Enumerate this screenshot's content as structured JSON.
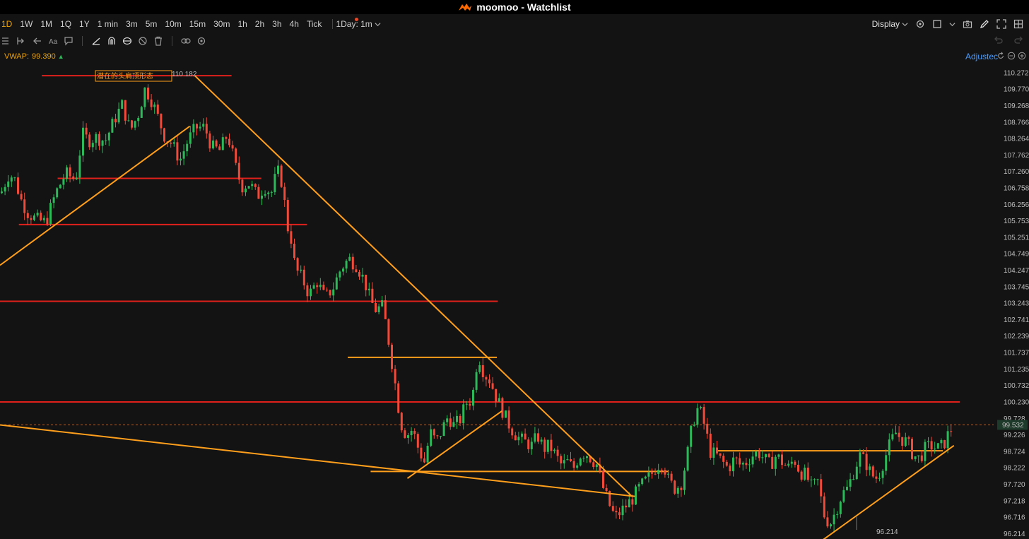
{
  "app": {
    "title": "moomoo - Watchlist"
  },
  "periods": [
    "1D",
    "1W",
    "1M",
    "1Q",
    "1Y",
    "1 min",
    "3m",
    "5m",
    "10m",
    "15m",
    "30m",
    "1h",
    "2h",
    "3h",
    "4h",
    "Tick"
  ],
  "active_period": "1D",
  "interval_select": "1Day: 1m",
  "display_label": "Display",
  "indicator": {
    "name": "VWAP:",
    "value": "99.390"
  },
  "adjusted_label": "Adjustec",
  "annotation_text": "潜在的头肩顶形态",
  "current_price_tag": "99.532",
  "colors": {
    "up": "#2db85a",
    "down": "#f04a3a",
    "trend_orange": "#ff9f1c",
    "level_red": "#e0211b",
    "accent": "#f0a500",
    "link_blue": "#4a9bff"
  },
  "chart_data": {
    "type": "candlestick",
    "y_axis": {
      "ticks": [
        "110.272",
        "109.770",
        "109.268",
        "108.766",
        "108.264",
        "107.762",
        "107.260",
        "106.758",
        "106.256",
        "105.753",
        "105.251",
        "104.749",
        "104.247",
        "103.745",
        "103.243",
        "102.741",
        "102.239",
        "101.737",
        "101.235",
        "100.732",
        "100.230",
        "99.728",
        "99.226",
        "98.724",
        "98.222",
        "97.720",
        "97.218",
        "96.716",
        "96.214"
      ],
      "range": [
        96.05,
        110.55
      ]
    },
    "high_label": "110.182",
    "low_label": "96.214",
    "current_price": 99.532,
    "vwap": 99.39,
    "horizontal_levels": [
      {
        "price": 110.182,
        "x_range": [
          0.042,
          0.233
        ],
        "color": "red"
      },
      {
        "price": 107.05,
        "x_range": [
          0.058,
          0.263
        ],
        "color": "red"
      },
      {
        "price": 105.64,
        "x_range": [
          0.019,
          0.309
        ],
        "color": "red"
      },
      {
        "price": 103.3,
        "x_range": [
          0.0,
          0.501
        ],
        "color": "red"
      },
      {
        "price": 100.23,
        "x_range": [
          0.0,
          0.966
        ],
        "color": "red"
      },
      {
        "price": 101.59,
        "x_range": [
          0.35,
          0.5
        ],
        "color": "orange"
      },
      {
        "price": 98.11,
        "x_range": [
          0.373,
          0.673
        ],
        "color": "orange"
      },
      {
        "price": 98.74,
        "x_range": [
          0.722,
          0.949
        ],
        "color": "orange"
      }
    ],
    "trend_lines": [
      {
        "from": [
          0.0,
          104.4
        ],
        "to": [
          0.191,
          108.64
        ],
        "color": "orange"
      },
      {
        "from": [
          0.196,
          110.182
        ],
        "to": [
          0.636,
          97.35
        ],
        "color": "orange"
      },
      {
        "from": [
          0.0,
          99.53
        ],
        "to": [
          0.639,
          97.35
        ],
        "color": "orange"
      },
      {
        "from": [
          0.41,
          97.9
        ],
        "to": [
          0.505,
          99.95
        ],
        "color": "orange"
      },
      {
        "from": [
          0.828,
          96.02
        ],
        "to": [
          0.96,
          98.9
        ],
        "color": "orange"
      }
    ],
    "price_path": [
      [
        0.0,
        106.6
      ],
      [
        0.008,
        107.2
      ],
      [
        0.014,
        107.0
      ],
      [
        0.02,
        106.4
      ],
      [
        0.027,
        106.0
      ],
      [
        0.035,
        105.8
      ],
      [
        0.045,
        105.7
      ],
      [
        0.055,
        106.6
      ],
      [
        0.065,
        107.2
      ],
      [
        0.075,
        107.0
      ],
      [
        0.082,
        108.4
      ],
      [
        0.088,
        108.2
      ],
      [
        0.095,
        108.3
      ],
      [
        0.105,
        108.2
      ],
      [
        0.115,
        108.9
      ],
      [
        0.122,
        109.3
      ],
      [
        0.13,
        108.5
      ],
      [
        0.138,
        109.0
      ],
      [
        0.145,
        109.8
      ],
      [
        0.152,
        109.4
      ],
      [
        0.158,
        108.9
      ],
      [
        0.165,
        108.3
      ],
      [
        0.172,
        108.1
      ],
      [
        0.18,
        107.6
      ],
      [
        0.188,
        108.2
      ],
      [
        0.196,
        108.6
      ],
      [
        0.205,
        108.6
      ],
      [
        0.212,
        108.0
      ],
      [
        0.22,
        107.9
      ],
      [
        0.228,
        108.4
      ],
      [
        0.236,
        107.4
      ],
      [
        0.242,
        106.8
      ],
      [
        0.25,
        106.9
      ],
      [
        0.258,
        106.5
      ],
      [
        0.265,
        106.8
      ],
      [
        0.272,
        106.6
      ],
      [
        0.278,
        107.3
      ],
      [
        0.283,
        106.9
      ],
      [
        0.288,
        105.6
      ],
      [
        0.292,
        105.2
      ],
      [
        0.296,
        104.3
      ],
      [
        0.303,
        104.0
      ],
      [
        0.31,
        103.5
      ],
      [
        0.318,
        103.9
      ],
      [
        0.326,
        103.4
      ],
      [
        0.334,
        103.7
      ],
      [
        0.342,
        104.3
      ],
      [
        0.35,
        104.6
      ],
      [
        0.358,
        104.4
      ],
      [
        0.366,
        103.9
      ],
      [
        0.372,
        103.3
      ],
      [
        0.378,
        103.0
      ],
      [
        0.383,
        103.2
      ],
      [
        0.388,
        102.5
      ],
      [
        0.393,
        101.5
      ],
      [
        0.398,
        100.5
      ],
      [
        0.402,
        99.6
      ],
      [
        0.408,
        99.2
      ],
      [
        0.414,
        99.4
      ],
      [
        0.42,
        98.8
      ],
      [
        0.426,
        98.4
      ],
      [
        0.432,
        99.3
      ],
      [
        0.438,
        99.0
      ],
      [
        0.444,
        99.4
      ],
      [
        0.45,
        99.8
      ],
      [
        0.456,
        99.5
      ],
      [
        0.462,
        99.7
      ],
      [
        0.468,
        100.2
      ],
      [
        0.474,
        100.3
      ],
      [
        0.48,
        101.7
      ],
      [
        0.486,
        101.1
      ],
      [
        0.492,
        100.9
      ],
      [
        0.498,
        100.4
      ],
      [
        0.504,
        100.0
      ],
      [
        0.51,
        99.6
      ],
      [
        0.516,
        99.3
      ],
      [
        0.522,
        99.1
      ],
      [
        0.528,
        99.0
      ],
      [
        0.534,
        98.9
      ],
      [
        0.54,
        99.2
      ],
      [
        0.546,
        98.8
      ],
      [
        0.552,
        98.9
      ],
      [
        0.558,
        98.6
      ],
      [
        0.564,
        98.3
      ],
      [
        0.57,
        98.4
      ],
      [
        0.576,
        98.2
      ],
      [
        0.582,
        98.6
      ],
      [
        0.588,
        98.7
      ],
      [
        0.594,
        98.5
      ],
      [
        0.6,
        98.3
      ],
      [
        0.606,
        97.6
      ],
      [
        0.612,
        97.1
      ],
      [
        0.618,
        96.7
      ],
      [
        0.624,
        96.9
      ],
      [
        0.63,
        97.1
      ],
      [
        0.636,
        97.3
      ],
      [
        0.642,
        97.6
      ],
      [
        0.648,
        97.8
      ],
      [
        0.654,
        98.0
      ],
      [
        0.66,
        98.3
      ],
      [
        0.666,
        98.4
      ],
      [
        0.672,
        97.8
      ],
      [
        0.678,
        97.6
      ],
      [
        0.684,
        97.7
      ],
      [
        0.69,
        98.5
      ],
      [
        0.696,
        99.6
      ],
      [
        0.702,
        100.1
      ],
      [
        0.708,
        99.5
      ],
      [
        0.714,
        98.7
      ],
      [
        0.72,
        98.6
      ],
      [
        0.726,
        98.4
      ],
      [
        0.732,
        98.2
      ],
      [
        0.738,
        98.5
      ],
      [
        0.744,
        98.3
      ],
      [
        0.75,
        98.4
      ],
      [
        0.756,
        98.6
      ],
      [
        0.762,
        98.7
      ],
      [
        0.768,
        98.5
      ],
      [
        0.774,
        98.3
      ],
      [
        0.78,
        98.6
      ],
      [
        0.786,
        98.4
      ],
      [
        0.792,
        98.2
      ],
      [
        0.798,
        98.5
      ],
      [
        0.804,
        98.1
      ],
      [
        0.81,
        98.0
      ],
      [
        0.816,
        97.6
      ],
      [
        0.822,
        97.8
      ],
      [
        0.828,
        96.8
      ],
      [
        0.834,
        96.5
      ],
      [
        0.84,
        96.9
      ],
      [
        0.846,
        97.4
      ],
      [
        0.852,
        97.6
      ],
      [
        0.858,
        98.1
      ],
      [
        0.864,
        98.6
      ],
      [
        0.87,
        98.4
      ],
      [
        0.876,
        98.0
      ],
      [
        0.882,
        97.9
      ],
      [
        0.888,
        98.4
      ],
      [
        0.894,
        98.9
      ],
      [
        0.9,
        99.3
      ],
      [
        0.906,
        99.1
      ],
      [
        0.912,
        99.0
      ],
      [
        0.918,
        98.6
      ],
      [
        0.924,
        98.5
      ],
      [
        0.93,
        98.8
      ],
      [
        0.936,
        98.9
      ],
      [
        0.942,
        98.8
      ],
      [
        0.948,
        98.9
      ],
      [
        0.954,
        99.3
      ],
      [
        0.958,
        99.5
      ]
    ]
  }
}
